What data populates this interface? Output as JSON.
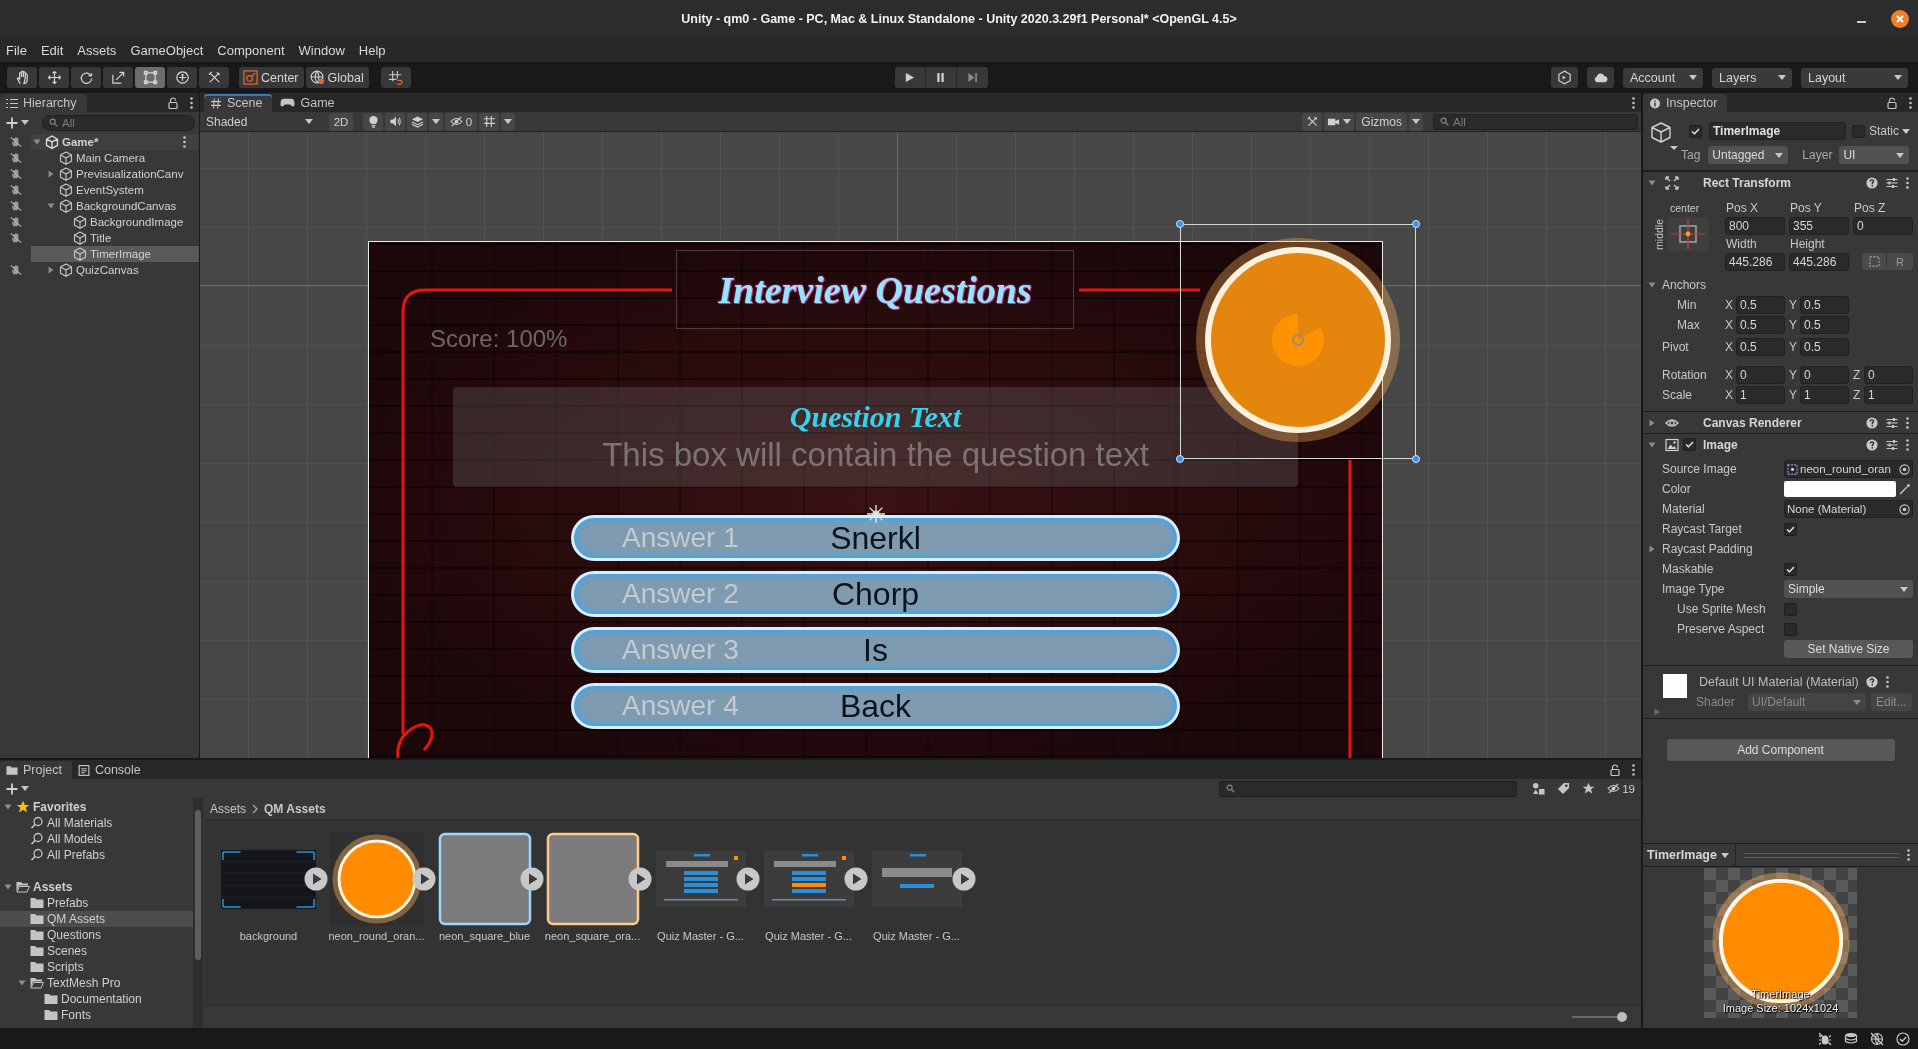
{
  "window": {
    "title": "Unity - qm0 - Game - PC, Mac & Linux Standalone - Unity 2020.3.29f1 Personal* <OpenGL 4.5>"
  },
  "menu": [
    "File",
    "Edit",
    "Assets",
    "GameObject",
    "Component",
    "Window",
    "Help"
  ],
  "toolbar": {
    "tools": [
      {
        "kind": "hand",
        "selected": false
      },
      {
        "kind": "move",
        "selected": false
      },
      {
        "kind": "rotate",
        "selected": false
      },
      {
        "kind": "scale",
        "selected": false
      },
      {
        "kind": "rect",
        "selected": true
      },
      {
        "kind": "transform",
        "selected": false
      },
      {
        "kind": "custom",
        "selected": false
      }
    ],
    "pivot_mode": "Center",
    "pivot_space": "Global",
    "account": "Account",
    "layers": "Layers",
    "layout": "Layout"
  },
  "hierarchy": {
    "title": "Hierarchy",
    "search_placeholder": "All",
    "tree": [
      {
        "name": "Game*",
        "kind": "scene",
        "expanded": true,
        "picking_disabled": true,
        "selected": false,
        "children": [
          {
            "name": "Main Camera",
            "kind": "object",
            "picking_disabled": true,
            "selected": false
          },
          {
            "name": "PrevisualizationCanv",
            "kind": "object",
            "expanded": false,
            "picking_disabled": true,
            "selected": false
          },
          {
            "name": "EventSystem",
            "kind": "object",
            "picking_disabled": true,
            "selected": false
          },
          {
            "name": "BackgroundCanvas",
            "kind": "object",
            "expanded": true,
            "picking_disabled": true,
            "selected": false,
            "children": [
              {
                "name": "BackgroundImage",
                "kind": "object",
                "picking_disabled": true,
                "selected": false
              },
              {
                "name": "Title",
                "kind": "object",
                "picking_disabled": true,
                "selected": false
              },
              {
                "name": "TimerImage",
                "kind": "object",
                "picking_disabled": false,
                "selected": true
              }
            ]
          },
          {
            "name": "QuizCanvas",
            "kind": "object",
            "expanded": false,
            "picking_disabled": true,
            "selected": false
          }
        ]
      }
    ]
  },
  "scene_panel": {
    "tabs": [
      {
        "label": "Scene",
        "kind": "scene",
        "selected": true
      },
      {
        "label": "Game",
        "kind": "game",
        "selected": false
      }
    ],
    "draw_mode": "Shaded",
    "mode_2d": "2D",
    "hidden_count": "0",
    "gizmos": "Gizmos",
    "search_placeholder": "All",
    "view": {
      "title": "Interview Questions",
      "score": "Score: 100%",
      "question": {
        "text": "Question Text",
        "default_text": "This box will contain the question text"
      },
      "answers": [
        {
          "text": "Snerkl",
          "default_text": "Answer 1"
        },
        {
          "text": "Chorp",
          "default_text": "Answer 2"
        },
        {
          "text": "Is",
          "default_text": "Answer 3"
        },
        {
          "text": "Back",
          "default_text": "Answer 4"
        }
      ],
      "timer": {
        "selected": true
      }
    }
  },
  "inspector": {
    "title": "Inspector",
    "object": {
      "active": true,
      "name": "TimerImage",
      "static": false,
      "static_label": "Static",
      "tag_label": "Tag",
      "tag": "Untagged",
      "layer_label": "Layer",
      "layer": "UI"
    },
    "rect_transform": {
      "title": "Rect Transform",
      "expanded": true,
      "anchor_h": "center",
      "anchor_v": "middle",
      "fields": [
        {
          "label": "Pos X",
          "value": "800"
        },
        {
          "label": "Pos Y",
          "value": "355"
        },
        {
          "label": "Pos Z",
          "value": "0"
        },
        {
          "label": "Width",
          "value": "445.286"
        },
        {
          "label": "Height",
          "value": "445.286"
        }
      ],
      "raw_edit": "R",
      "anchors": {
        "title": "Anchors",
        "expanded": true,
        "rows": [
          {
            "label": "Min",
            "values": [
              {
                "axis": "X",
                "value": "0.5"
              },
              {
                "axis": "Y",
                "value": "0.5"
              }
            ]
          },
          {
            "label": "Max",
            "values": [
              {
                "axis": "X",
                "value": "0.5"
              },
              {
                "axis": "Y",
                "value": "0.5"
              }
            ]
          }
        ]
      },
      "vectors": [
        {
          "label": "Pivot",
          "values": [
            {
              "axis": "X",
              "value": "0.5"
            },
            {
              "axis": "Y",
              "value": "0.5"
            }
          ]
        },
        {
          "label": "Rotation",
          "values": [
            {
              "axis": "X",
              "value": "0"
            },
            {
              "axis": "Y",
              "value": "0"
            },
            {
              "axis": "Z",
              "value": "0"
            }
          ]
        },
        {
          "label": "Scale",
          "values": [
            {
              "axis": "X",
              "value": "1"
            },
            {
              "axis": "Y",
              "value": "1"
            },
            {
              "axis": "Z",
              "value": "1"
            }
          ]
        }
      ]
    },
    "canvas_renderer": {
      "title": "Canvas Renderer",
      "expanded": false
    },
    "image": {
      "title": "Image",
      "expanded": true,
      "enabled": true,
      "properties": [
        {
          "kind": "sprite",
          "label": "Source Image",
          "value": "neon_round_oran"
        },
        {
          "kind": "color",
          "label": "Color",
          "color": "#ffffff"
        },
        {
          "kind": "object",
          "label": "Material",
          "value": "None (Material)"
        },
        {
          "kind": "toggle",
          "label": "Raycast Target",
          "checked": true
        },
        {
          "kind": "foldout",
          "label": "Raycast Padding",
          "expanded": false
        },
        {
          "kind": "toggle",
          "label": "Maskable",
          "checked": true
        },
        {
          "kind": "dropdown",
          "label": "Image Type",
          "value": "Simple",
          "children": [
            {
              "kind": "toggle",
              "label": "Use Sprite Mesh",
              "checked": false
            },
            {
              "kind": "toggle",
              "label": "Preserve Aspect",
              "checked": false
            }
          ]
        },
        {
          "kind": "button",
          "label": "Set Native Size"
        }
      ]
    },
    "material": {
      "title": "Default UI Material (Material)",
      "expanded": false,
      "shader_label": "Shader",
      "shader": "UI/Default",
      "edit": "Edit..."
    },
    "add_component": "Add Component",
    "preview": {
      "title": "TimerImage",
      "name": "TimerImage",
      "size": "Image Size: 1024x1024"
    }
  },
  "project_panel": {
    "tabs": [
      {
        "label": "Project",
        "kind": "project",
        "selected": true
      },
      {
        "label": "Console",
        "kind": "console",
        "selected": false
      }
    ],
    "hidden_count": "19",
    "tree": [
      {
        "name": "Favorites",
        "kind": "favorites",
        "expanded": true,
        "selected": false,
        "children": [
          {
            "name": "All Materials",
            "kind": "search",
            "selected": false
          },
          {
            "name": "All Models",
            "kind": "search",
            "selected": false
          },
          {
            "name": "All Prefabs",
            "kind": "search",
            "selected": false
          }
        ]
      },
      {
        "name": "Assets",
        "kind": "folder",
        "expanded": true,
        "selected": false,
        "children": [
          {
            "name": "Prefabs",
            "kind": "folder",
            "selected": false
          },
          {
            "name": "QM Assets",
            "kind": "folder",
            "selected": true
          },
          {
            "name": "Questions",
            "kind": "folder",
            "selected": false
          },
          {
            "name": "Scenes",
            "kind": "folder",
            "selected": false
          },
          {
            "name": "Scripts",
            "kind": "folder",
            "selected": false
          },
          {
            "name": "TextMesh Pro",
            "kind": "folder",
            "expanded": true,
            "selected": false,
            "children": [
              {
                "name": "Documentation",
                "kind": "folder",
                "selected": false
              },
              {
                "name": "Fonts",
                "kind": "folder",
                "selected": false
              }
            ]
          }
        ]
      }
    ],
    "breadcrumb": [
      "Assets",
      "QM Assets"
    ],
    "assets": [
      {
        "name": "background",
        "kind": "brick"
      },
      {
        "name": "neon_round_oran...",
        "kind": "round_orange"
      },
      {
        "name": "neon_square_blue",
        "kind": "square_blue"
      },
      {
        "name": "neon_square_ora...",
        "kind": "square_orange"
      },
      {
        "name": "Quiz Master - G...",
        "kind": "quiz_question"
      },
      {
        "name": "Quiz Master - G...",
        "kind": "quiz_answer"
      },
      {
        "name": "Quiz Master - G...",
        "kind": "quiz_end"
      }
    ],
    "size_slider": {
      "level": 0.9
    }
  }
}
